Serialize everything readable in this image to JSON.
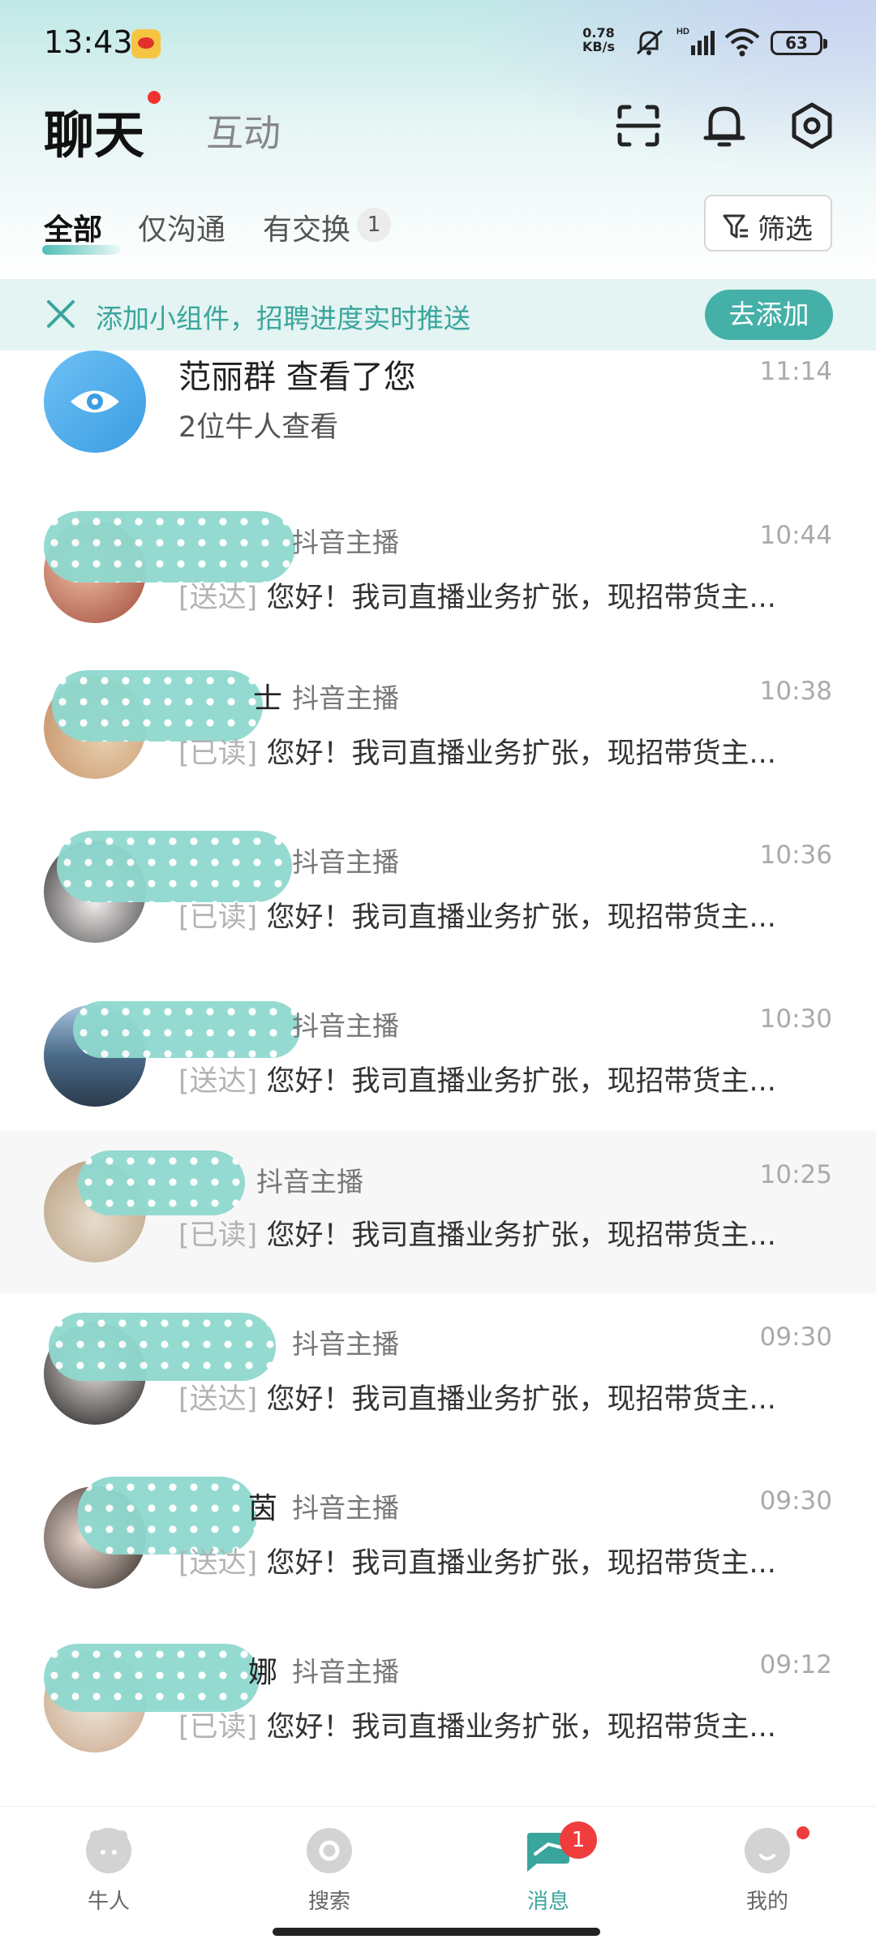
{
  "status_bar": {
    "time": "13:43",
    "net_speed_value": "0.78",
    "net_speed_unit": "KB/s",
    "battery": "63"
  },
  "header": {
    "title": "聊天",
    "tab_interact": "互动"
  },
  "filter_tabs": {
    "all": "全部",
    "only_chat": "仅沟通",
    "exchanged": "有交换",
    "exchanged_count": "1",
    "filter_label": "筛选"
  },
  "banner": {
    "text": "添加小组件，招聘进度实时推送",
    "button": "去添加"
  },
  "viewer_row": {
    "title": "范丽群 查看了您",
    "subtitle": "2位牛人查看",
    "time": "11:14"
  },
  "chats": [
    {
      "name_suffix": "",
      "tag": "抖音主播",
      "time": "10:44",
      "status": "[送达]",
      "message": "您好！我司直播业务扩张，现招带货主..."
    },
    {
      "name_suffix": "士",
      "tag": "抖音主播",
      "time": "10:38",
      "status": "[已读]",
      "message": "您好！我司直播业务扩张，现招带货主..."
    },
    {
      "name_suffix": "",
      "tag": "抖音主播",
      "time": "10:36",
      "status": "[已读]",
      "message": "您好！我司直播业务扩张，现招带货主..."
    },
    {
      "name_suffix": "",
      "tag": "抖音主播",
      "time": "10:30",
      "status": "[送达]",
      "message": "您好！我司直播业务扩张，现招带货主..."
    },
    {
      "name_suffix": "",
      "tag": "抖音主播",
      "time": "10:25",
      "status": "[已读]",
      "message": "您好！我司直播业务扩张，现招带货主..."
    },
    {
      "name_suffix": "",
      "tag": "抖音主播",
      "time": "09:30",
      "status": "[送达]",
      "message": "您好！我司直播业务扩张，现招带货主..."
    },
    {
      "name_suffix": "茵",
      "tag": "抖音主播",
      "time": "09:30",
      "status": "[送达]",
      "message": "您好！我司直播业务扩张，现招带货主..."
    },
    {
      "name_suffix": "娜",
      "tag": "抖音主播",
      "time": "09:12",
      "status": "[已读]",
      "message": "您好！我司直播业务扩张，现招带货主..."
    }
  ],
  "bottom_nav": {
    "talent": "牛人",
    "search": "搜索",
    "messages": "消息",
    "messages_badge": "1",
    "mine": "我的"
  },
  "colors": {
    "accent": "#44b0a7",
    "badge_red": "#ef3d3d"
  }
}
